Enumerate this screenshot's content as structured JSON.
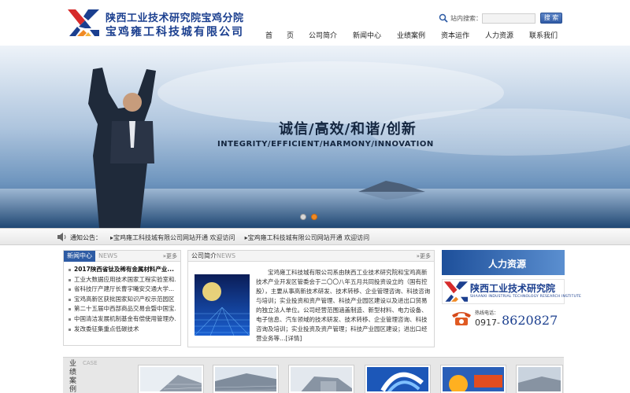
{
  "header": {
    "org_name": "陕西工业技术研究院宝鸡分院",
    "company_name": "宝鸡雍工科技城有限公司",
    "search_label": "站内搜索：",
    "search_value": "",
    "search_button": "搜 索"
  },
  "nav": {
    "items": [
      "首　　页",
      "公司简介",
      "新闻中心",
      "业绩案例",
      "资本运作",
      "人力资源",
      "联系我们"
    ]
  },
  "banner": {
    "slogan_cn": "诚信/高效/和谐/创新",
    "slogan_en": "INTEGRITY/EFFICIENT/HARMONY/INNOVATION",
    "slide_count": 2,
    "active_slide": 2
  },
  "notice": {
    "label": "通知公告：",
    "items": [
      "▸宝鸡雍工科技城有限公司网站开通 欢迎访问",
      "▸宝鸡雍工科技城有限公司网站开通 欢迎访问"
    ]
  },
  "news": {
    "title": "新闻中心",
    "title_en": "NEWS",
    "more": "更多",
    "items": [
      "2017陕西省钛及稀有金属材料产业...",
      "工业大数据应用技术国家工程实验室和...",
      "省科技厅产建厅长曹宇曦安交通大学...",
      "宝鸡高新区获批国家知识产权示范园区",
      "第二十五届中西部商品交易会暨中国宝...",
      "中国清洁发展机制基金有偿使用管理办...",
      "发改委征集重点低碳技术"
    ]
  },
  "about": {
    "title": "公司简介",
    "title_en": "NEWS",
    "more": "更多",
    "text": "宝鸡雍工科技城有限公司系由陕西工业技术研究院和宝鸡高新技术产业开发区管委会于二〇〇八年五月共同投资设立的（国有控股），主要从事高新技术研发、技术转移、企业管理咨询、科技咨询与培训；实业投资和资产管理、科技产业园区建设以及进出口贸易的独立法人单位。公司经营范围涵盖制造、新型材料、电力设备、电子信息、汽车领域的技术研发、技术转移、企业管理咨询、科技咨询及培训；实业投资及资产管理；科技产业园区建设；进出口经营业务等…[详情]"
  },
  "sidebar": {
    "hr_title": "人力资源",
    "org_cn": "陕西工业技术研究院",
    "org_en": "SHAANXI INDUSTRIAL TECHNOLOGY RESEARCH INSTITUTE",
    "phone_label": "热线电话：",
    "phone_prefix": "0917-",
    "phone_number": "8620827"
  },
  "cases": {
    "title": "业绩案例",
    "title_en": "CASE"
  },
  "colors": {
    "brand_blue": "#1b3f8f",
    "nav_blue": "#2d5ba4",
    "accent_orange": "#f08a24"
  }
}
